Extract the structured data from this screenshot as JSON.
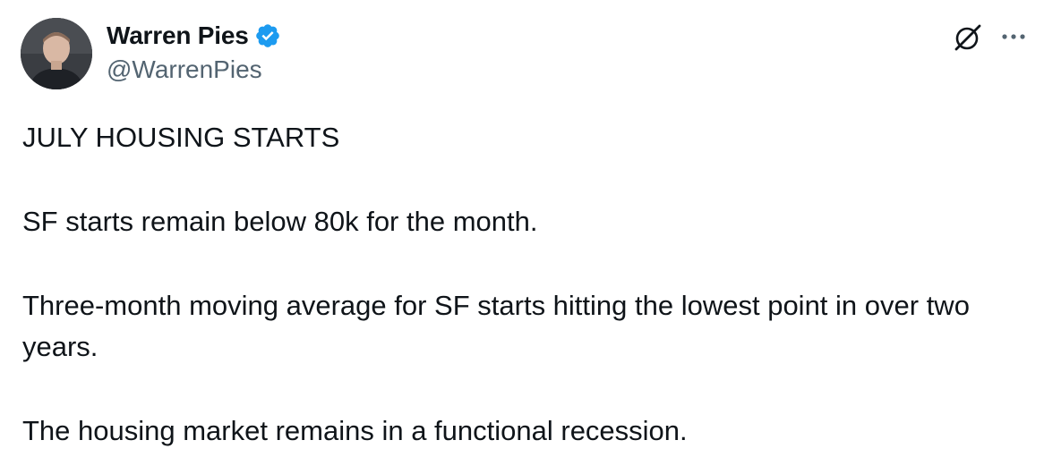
{
  "author": {
    "display_name": "Warren Pies",
    "handle": "@WarrenPies",
    "verified": true,
    "verified_color": "#1d9bf0"
  },
  "actions": {
    "grok_icon": "grok-icon",
    "more_icon": "more-icon"
  },
  "tweet": {
    "paragraphs": [
      "JULY HOUSING STARTS",
      "SF starts remain below 80k for the month.",
      "Three-month moving average for SF starts hitting the lowest point in over two years.",
      "The housing market remains in a functional recession."
    ]
  },
  "colors": {
    "text": "#0f1419",
    "secondary": "#536471",
    "background": "#ffffff"
  }
}
